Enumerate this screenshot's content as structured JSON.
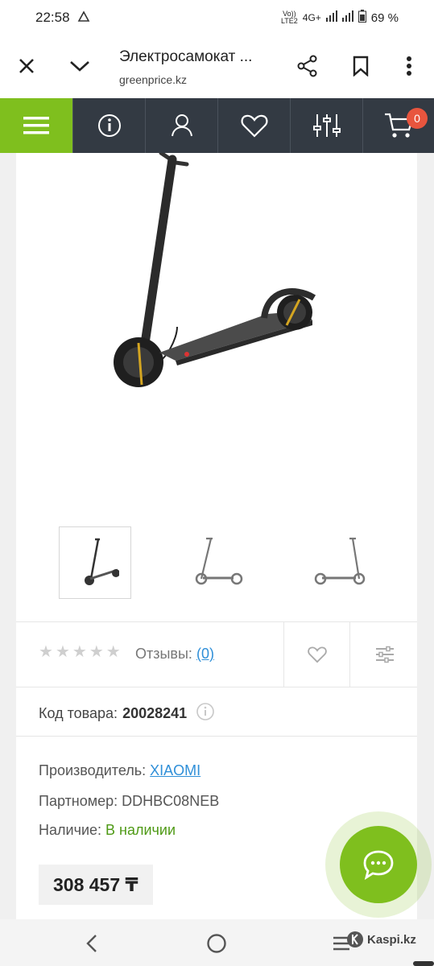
{
  "status_bar": {
    "time": "22:58",
    "network": "4G+",
    "volte_line1": "Vo))",
    "volte_line2": "LTE2",
    "battery": "69 %"
  },
  "browser": {
    "title": "Электросамокат ...",
    "url": "greenprice.kz",
    "icons": [
      "close-icon",
      "chevron-down-icon",
      "share-icon",
      "bookmark-icon",
      "more-vertical-icon"
    ]
  },
  "site_nav": {
    "accent": "#7fbf1e",
    "background": "#333a43",
    "items": [
      "menu-icon",
      "info-icon",
      "user-icon",
      "heart-icon",
      "compare-icon",
      "cart-icon"
    ],
    "cart_count": "0"
  },
  "product": {
    "rating_label": "Отзывы:",
    "reviews_count": "(0)",
    "stars_filled": 0,
    "stars_total": 5,
    "code_label": "Код товара:",
    "code_value": "20028241",
    "manufacturer_label": "Производитель:",
    "manufacturer_value": "XIAOMI",
    "partnumber_label": "Партномер:",
    "partnumber_value": "DDHBC08NEB",
    "availability_label": "Наличие:",
    "availability_value": "В наличии",
    "price": "308 457 ₸"
  },
  "bottom_bar": {
    "kaspi_label": "Kaspi.kz"
  }
}
